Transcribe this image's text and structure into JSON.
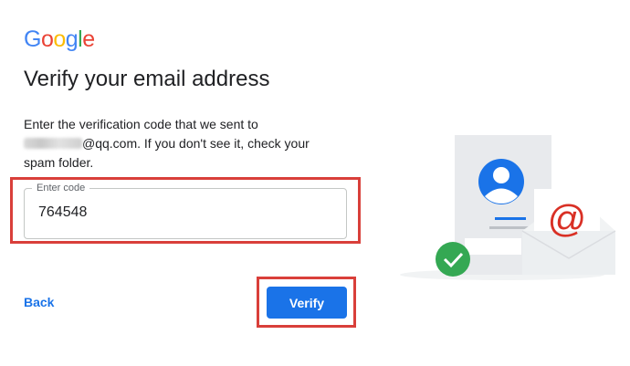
{
  "brand": {
    "logo_letters": [
      {
        "char": "G",
        "color": "#4285F4"
      },
      {
        "char": "o",
        "color": "#EA4335"
      },
      {
        "char": "o",
        "color": "#FBBC05"
      },
      {
        "char": "g",
        "color": "#4285F4"
      },
      {
        "char": "l",
        "color": "#34A853"
      },
      {
        "char": "e",
        "color": "#EA4335"
      }
    ]
  },
  "heading": "Verify your email address",
  "description": {
    "line1": "Enter the verification code that we sent to",
    "email_suffix": "@qq.com. If you don't see it, check your",
    "line3": "spam folder."
  },
  "code_field": {
    "label": "Enter code",
    "value": "764548"
  },
  "actions": {
    "back_label": "Back",
    "verify_label": "Verify"
  },
  "colors": {
    "accent": "#1a73e8",
    "highlight": "#d93f3a",
    "success": "#34A853",
    "mail_at": "#d93025"
  },
  "illustration": {
    "icons": [
      "contact-card-icon",
      "avatar-icon",
      "envelope-icon",
      "at-sign-icon",
      "check-circle-icon"
    ]
  }
}
